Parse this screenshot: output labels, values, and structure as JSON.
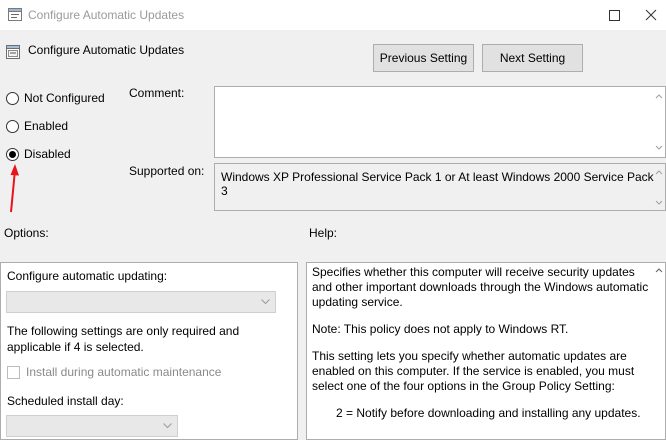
{
  "window": {
    "title": "Configure Automatic Updates"
  },
  "policy": {
    "title": "Configure Automatic Updates"
  },
  "nav": {
    "previous_label": "Previous Setting",
    "next_label": "Next Setting"
  },
  "state": {
    "options": [
      {
        "label": "Not Configured",
        "checked": false
      },
      {
        "label": "Enabled",
        "checked": false
      },
      {
        "label": "Disabled",
        "checked": true
      }
    ]
  },
  "comment": {
    "label": "Comment:",
    "value": ""
  },
  "supported": {
    "label": "Supported on:",
    "value": "Windows XP Professional Service Pack 1 or At least Windows 2000 Service Pack 3"
  },
  "options_section": {
    "header": "Options:",
    "configure_label": "Configure automatic updating:",
    "note": "The following settings are only required and applicable if 4 is selected.",
    "install_maintenance_label": "Install during automatic maintenance",
    "scheduled_day_label": "Scheduled install day:"
  },
  "help_section": {
    "header": "Help:",
    "paragraphs": [
      "Specifies whether this computer will receive security updates and other important downloads through the Windows automatic updating service.",
      "Note: This policy does not apply to Windows RT.",
      "This setting lets you specify whether automatic updates are enabled on this computer. If the service is enabled, you must select one of the four options in the Group Policy Setting:",
      "2 = Notify before downloading and installing any updates."
    ]
  },
  "colors": {
    "window_bg": "#f0f0f0",
    "annotation_arrow": "#e8141b"
  },
  "icons": {
    "app": "policy-window-icon",
    "policy": "policy-setting-icon"
  }
}
